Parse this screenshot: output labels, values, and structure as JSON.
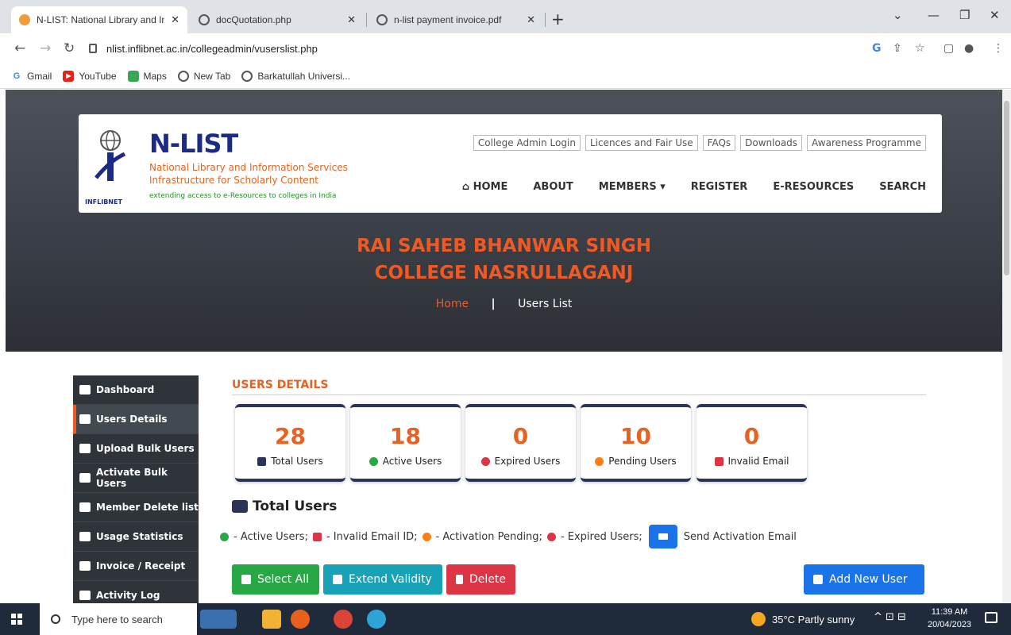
{
  "browser": {
    "tabs": [
      {
        "title": "N-LIST: National Library and Info"
      },
      {
        "title": "docQuotation.php"
      },
      {
        "title": "n-list payment invoice.pdf"
      }
    ],
    "url": "nlist.inflibnet.ac.in/collegeadmin/vuserslist.php",
    "bookmarks": [
      "Gmail",
      "YouTube",
      "Maps",
      "New Tab",
      "Barkatullah Universi..."
    ],
    "bookmark_icons": [
      "G",
      "▶",
      "",
      "",
      ""
    ]
  },
  "header": {
    "brand": "N-LIST",
    "line1": "National Library and Information Services",
    "line2": "Infrastructure for Scholarly Content",
    "line3": "extending access to e-Resources to colleges in India",
    "logo_text": "INFLIBNET",
    "top_links": [
      "College Admin Login",
      "Licences and Fair Use",
      "FAQs",
      "Downloads",
      "Awareness Programme"
    ],
    "nav": [
      "HOME",
      "ABOUT",
      "MEMBERS",
      "REGISTER",
      "E-RESOURCES",
      "SEARCH"
    ]
  },
  "hero": {
    "title_line1": "RAI SAHEB BHANWAR SINGH",
    "title_line2": "COLLEGE NASRULLAGANJ",
    "crumb_home": "Home",
    "crumb_sep": "|",
    "crumb_current": "Users List"
  },
  "sidebar": {
    "items": [
      {
        "label": "Dashboard"
      },
      {
        "label": "Users Details"
      },
      {
        "label": "Upload Bulk Users"
      },
      {
        "label": "Activate Bulk Users"
      },
      {
        "label": "Member Delete list"
      },
      {
        "label": "Usage Statistics"
      },
      {
        "label": "Invoice / Receipt"
      },
      {
        "label": "Activity Log"
      }
    ]
  },
  "content": {
    "section_title": "USERS DETAILS",
    "stats": [
      {
        "value": "28",
        "label": "Total Users",
        "color": "#2b3356"
      },
      {
        "value": "18",
        "label": "Active Users",
        "color": "#28a745"
      },
      {
        "value": "0",
        "label": "Expired Users",
        "color": "#dc3545"
      },
      {
        "value": "10",
        "label": "Pending Users",
        "color": "#fd7e14"
      },
      {
        "value": "0",
        "label": "Invalid Email",
        "color": "#dc3545"
      }
    ],
    "total_heading": "Total Users",
    "legend": {
      "active": "- Active Users;",
      "invalid": "- Invalid Email ID;",
      "pending": "- Activation Pending;",
      "expired": "- Expired Users;",
      "send": "Send Activation Email"
    },
    "buttons": {
      "select_all": "Select All",
      "extend": "Extend Validity",
      "delete": "Delete",
      "add_user": "Add New User"
    }
  },
  "taskbar": {
    "search_placeholder": "Type here to search",
    "weather": "35°C  Partly sunny",
    "time": "11:39 AM",
    "date": "20/04/2023"
  },
  "colors": {
    "accent_orange": "#f05a22",
    "brand_blue": "#1b2a84",
    "btn_green": "#28a745",
    "btn_teal": "#17a2b8",
    "btn_red": "#dc3545",
    "btn_blue": "#1a73e8"
  }
}
